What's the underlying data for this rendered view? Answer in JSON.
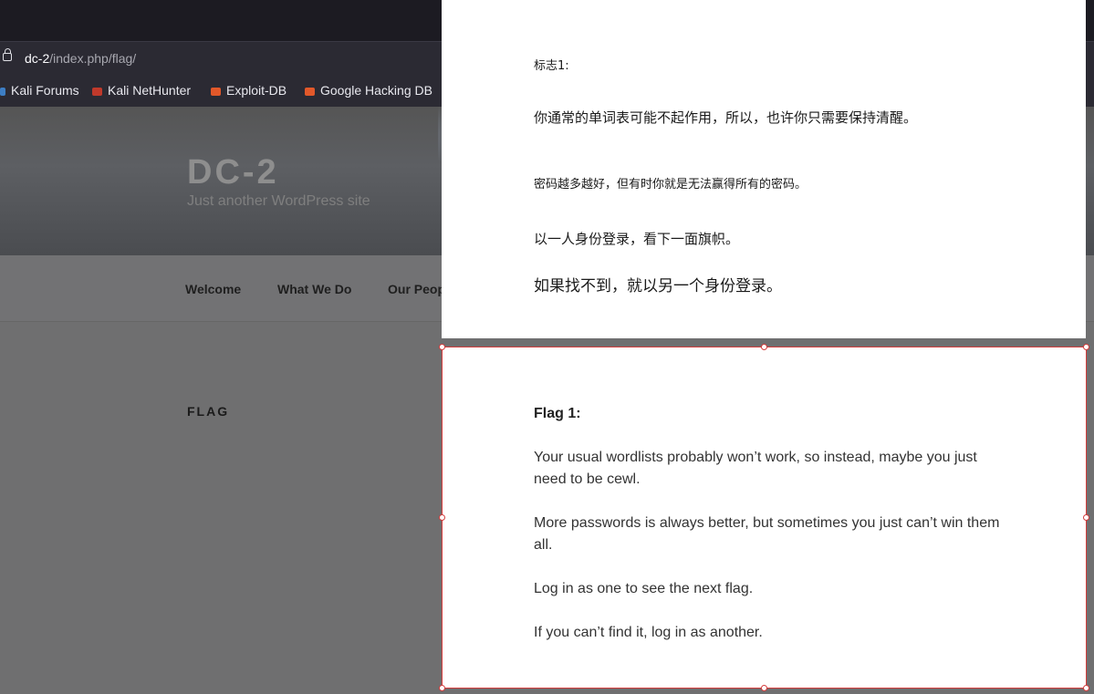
{
  "browser": {
    "url_host": "dc-2",
    "url_path": "/index.php/flag/",
    "bookmarks": [
      {
        "label": "Kali Forums",
        "icon": "kali-icon",
        "color": "#3d7ec4"
      },
      {
        "label": "Kali NetHunter",
        "icon": "nethunter-icon",
        "color": "#c0392b"
      },
      {
        "label": "Exploit-DB",
        "icon": "exploitdb-icon",
        "color": "#e2582a"
      },
      {
        "label": "Google Hacking DB",
        "icon": "ghdb-icon",
        "color": "#e2582a"
      }
    ]
  },
  "site": {
    "title": "DC-2",
    "description": "Just another WordPress site",
    "nav": [
      "Welcome",
      "What We Do",
      "Our Peop"
    ],
    "page_heading": "FLAG"
  },
  "translation_cn": {
    "lines": [
      "标志1:",
      "你通常的单词表可能不起作用，所以，也许你只需要保持清醒。",
      "密码越多越好，但有时你就是无法赢得所有的密码。",
      "以一人身份登录，看下一面旗帜。",
      "如果找不到，就以另一个身份登录。"
    ]
  },
  "flag_en": {
    "title": "Flag 1:",
    "paragraphs": [
      "Your usual wordlists probably won’t work, so instead, maybe you just need to be cewl.",
      "More passwords is always better, but sometimes you just can’t win them all.",
      "Log in as one to see the next flag.",
      "If you can’t find it, log in as another."
    ]
  }
}
